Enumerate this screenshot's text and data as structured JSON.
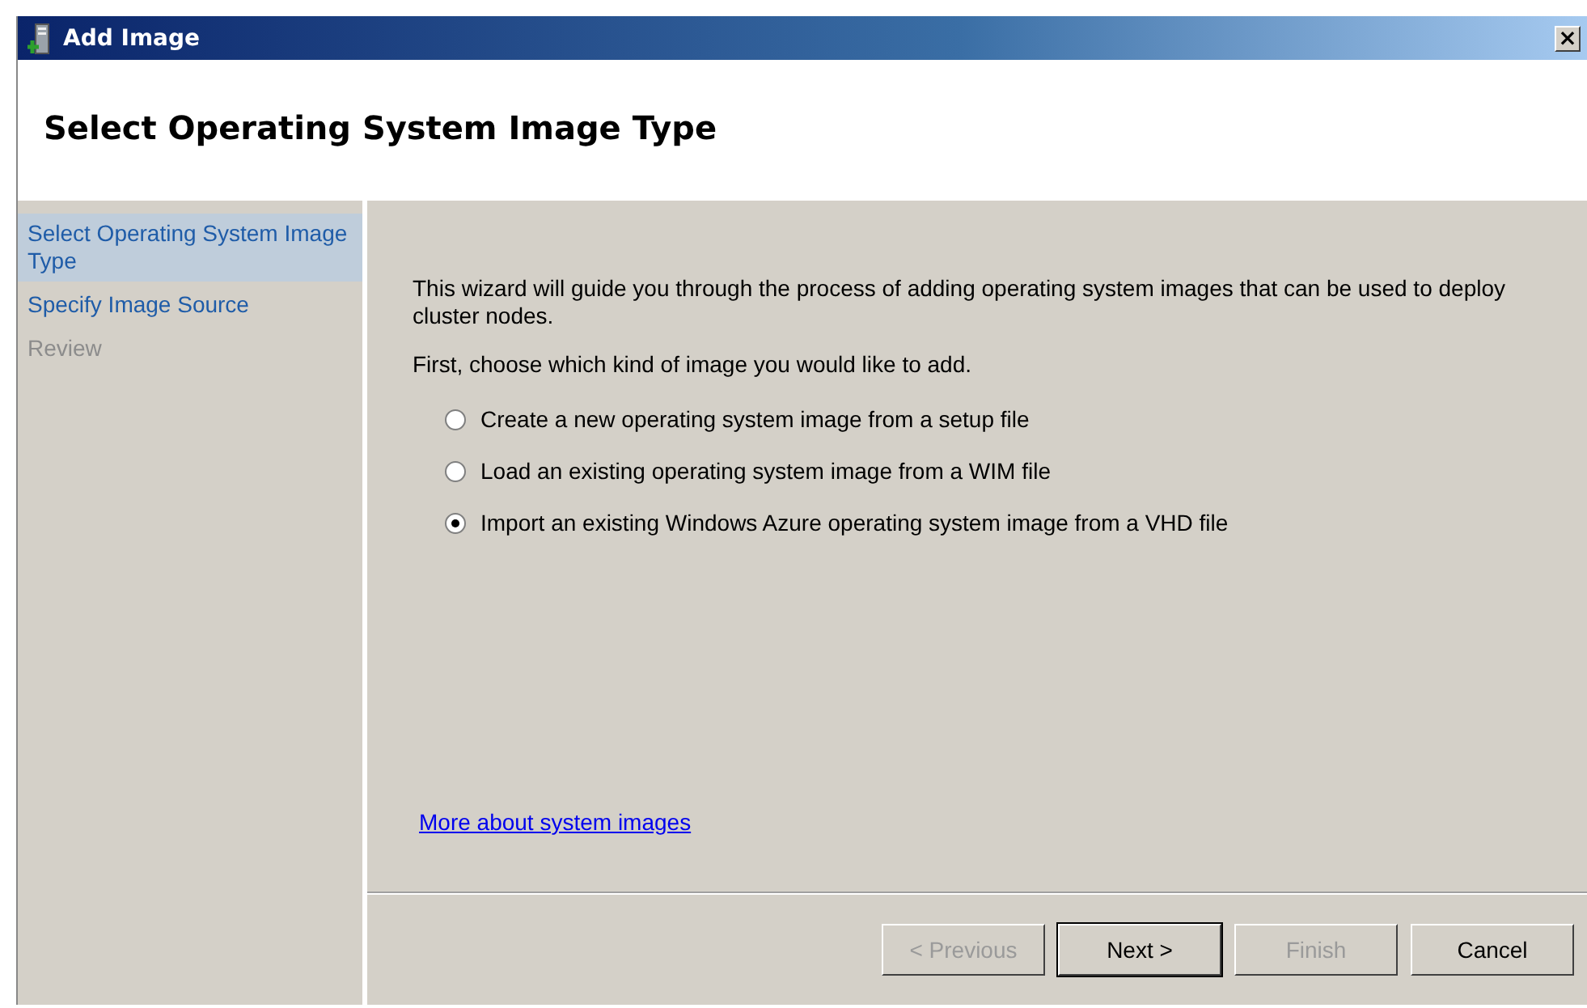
{
  "window": {
    "title": "Add Image",
    "close": "×"
  },
  "header": {
    "title": "Select Operating System Image Type"
  },
  "sidebar": {
    "items": [
      {
        "label": "Select Operating System Image Type",
        "selected": true,
        "disabled": false
      },
      {
        "label": "Specify Image Source",
        "selected": false,
        "disabled": false
      },
      {
        "label": "Review",
        "selected": false,
        "disabled": true
      }
    ]
  },
  "content": {
    "intro": "This wizard will guide you through the process of adding operating system images that can be used to deploy cluster nodes.",
    "prompt": "First, choose which kind of image you would like to add.",
    "options": [
      {
        "label": "Create a new operating system image from a setup file",
        "selected": false
      },
      {
        "label": "Load an existing operating system image from a WIM file",
        "selected": false
      },
      {
        "label": "Import an existing Windows Azure operating system image from a VHD file",
        "selected": true
      }
    ],
    "link": "More about system images"
  },
  "buttons": [
    {
      "label": "< Previous",
      "disabled": true,
      "default": false
    },
    {
      "label": "Next >",
      "disabled": false,
      "default": true
    },
    {
      "label": "Finish",
      "disabled": true,
      "default": false
    },
    {
      "label": "Cancel",
      "disabled": false,
      "default": false
    }
  ]
}
